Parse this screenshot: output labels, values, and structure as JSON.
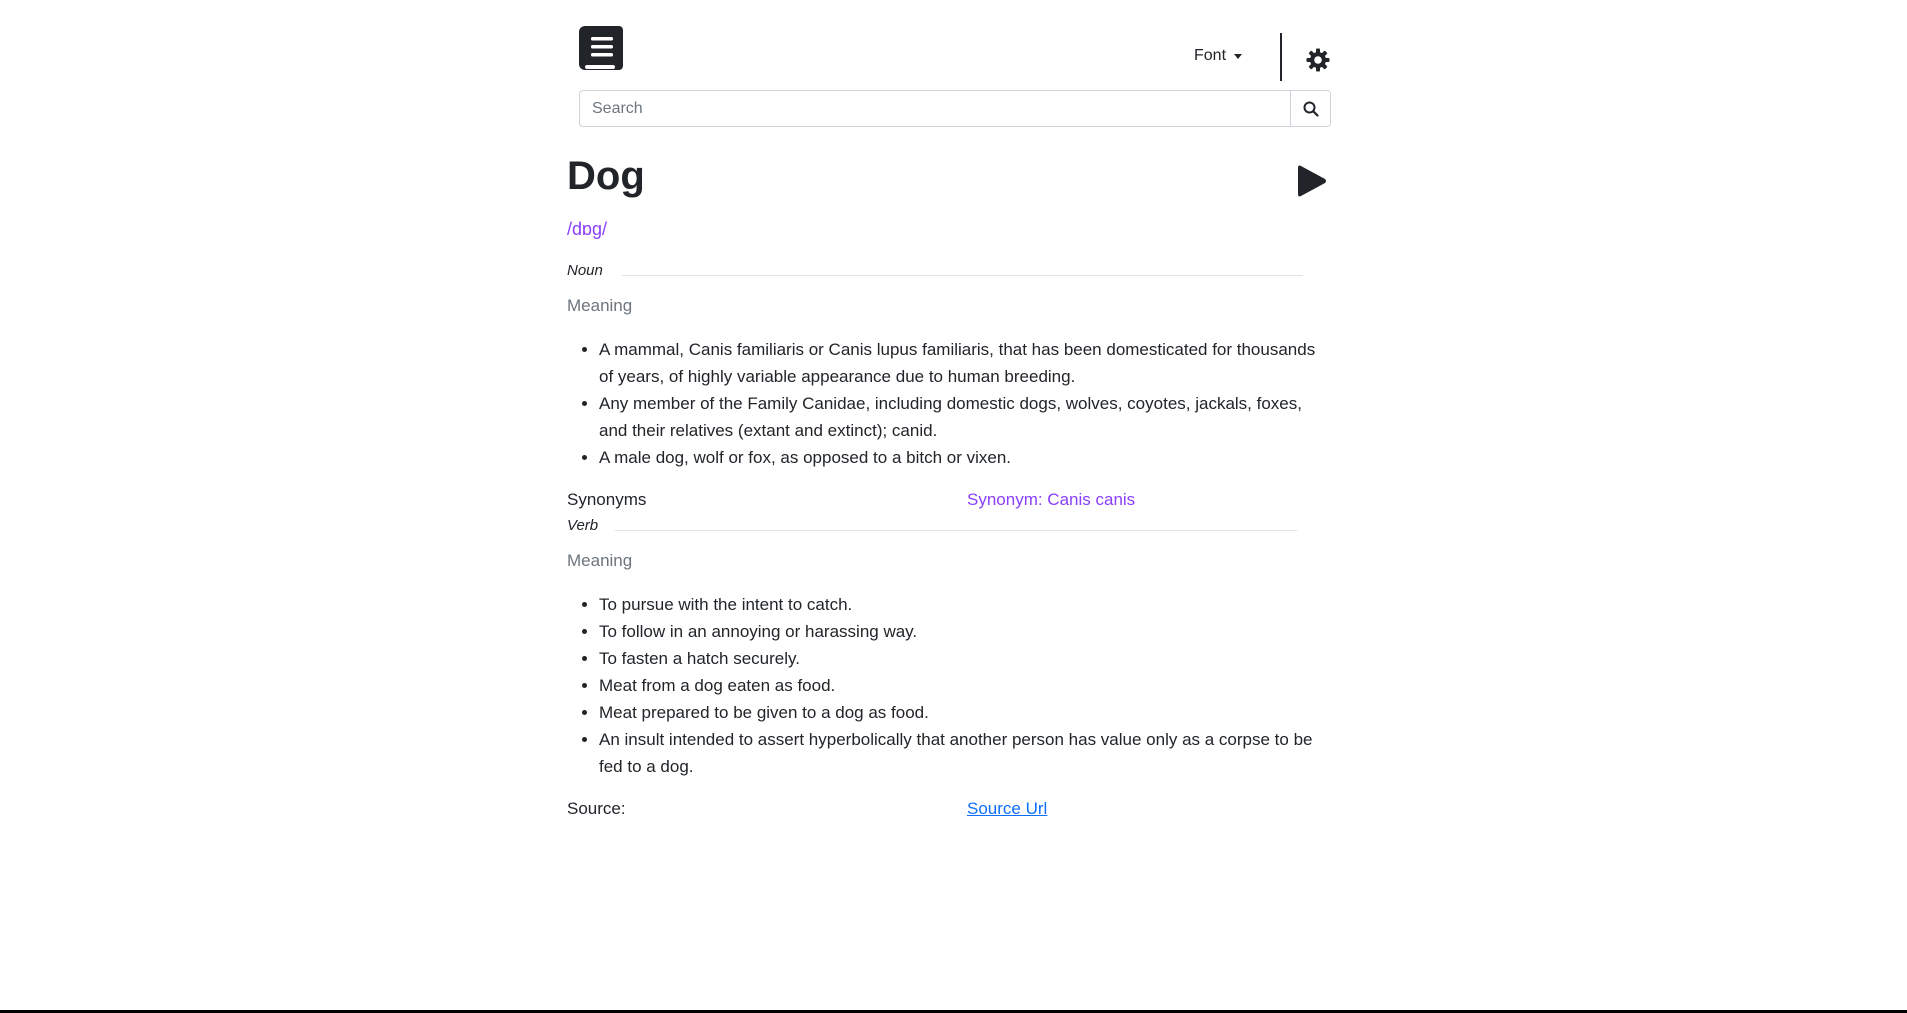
{
  "header": {
    "logo": "book-icon",
    "font_label": "Font",
    "theme_icon": "gear-icon"
  },
  "search": {
    "placeholder": "Search",
    "value": "",
    "button_icon": "search-icon"
  },
  "entry": {
    "word": "Dog",
    "phonetic": "/dɒg/",
    "play_icon": "play-icon",
    "noun": {
      "pos": "Noun",
      "meaning_label": "Meaning",
      "definitions": [
        "A mammal, Canis familiaris or Canis lupus familiaris, that has been domesticated for thousands of years, of highly variable appearance due to human breeding.",
        "Any member of the Family Canidae, including domestic dogs, wolves, coyotes, jackals, foxes, and their relatives (extant and extinct); canid.",
        "A male dog, wolf or fox, as opposed to a bitch or vixen."
      ],
      "synonyms_label": "Synonyms",
      "synonym": "Synonym: Canis canis"
    },
    "verb": {
      "pos": "Verb",
      "meaning_label": "Meaning",
      "definitions": [
        "To pursue with the intent to catch.",
        "To follow in an annoying or harassing way.",
        "To fasten a hatch securely.",
        "Meat from a dog eaten as food.",
        "Meat prepared to be given to a dog as food.",
        "An insult intended to assert hyperbolically that another person has value only as a corpse to be fed to a dog."
      ]
    },
    "source_label": "Source:",
    "source_link": "Source Url"
  },
  "colors": {
    "accent": "#8a3ffc",
    "link": "#0d6efd",
    "text": "#212529",
    "muted": "#6c757d"
  }
}
